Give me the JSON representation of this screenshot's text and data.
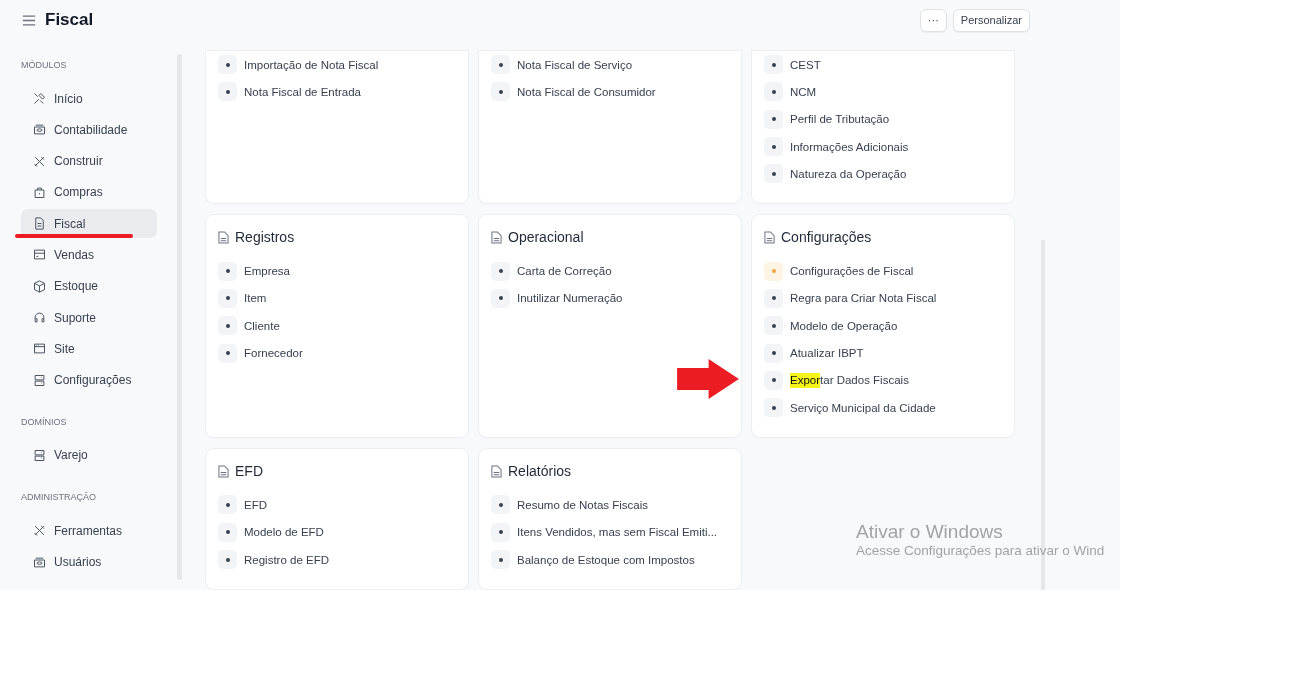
{
  "header": {
    "title": "Fiscal",
    "more_button": "···",
    "customize_button": "Personalizar"
  },
  "sidebar": {
    "sections": [
      {
        "heading": "MÓDULOS",
        "items": [
          {
            "label": "Início",
            "selected": false,
            "underlined": false
          },
          {
            "label": "Contabilidade",
            "selected": false,
            "underlined": false
          },
          {
            "label": "Construir",
            "selected": false,
            "underlined": false
          },
          {
            "label": "Compras",
            "selected": false,
            "underlined": false
          },
          {
            "label": "Fiscal",
            "selected": true,
            "underlined": true
          },
          {
            "label": "Vendas",
            "selected": false,
            "underlined": false
          },
          {
            "label": "Estoque",
            "selected": false,
            "underlined": false
          },
          {
            "label": "Suporte",
            "selected": false,
            "underlined": false
          },
          {
            "label": "Site",
            "selected": false,
            "underlined": false
          },
          {
            "label": "Configurações",
            "selected": false,
            "underlined": false
          }
        ]
      },
      {
        "heading": "DOMÍNIOS",
        "items": [
          {
            "label": "Varejo",
            "selected": false,
            "underlined": false
          }
        ]
      },
      {
        "heading": "ADMINISTRAÇÃO",
        "items": [
          {
            "label": "Ferramentas",
            "selected": false,
            "underlined": false
          },
          {
            "label": "Usuários",
            "selected": false,
            "underlined": false
          }
        ]
      }
    ]
  },
  "cards": [
    {
      "links": [
        {
          "label": "Importação de Nota Fiscal",
          "color": "#374151"
        },
        {
          "label": "Nota Fiscal de Entrada",
          "color": "#374151"
        }
      ]
    },
    {
      "links": [
        {
          "label": "Nota Fiscal de Serviço",
          "color": "#374151"
        },
        {
          "label": "Nota Fiscal de Consumidor",
          "color": "#374151"
        }
      ]
    },
    {
      "links": [
        {
          "label": "CEST",
          "color": "#374151"
        },
        {
          "label": "NCM",
          "color": "#374151"
        },
        {
          "label": "Perfil de Tributação",
          "color": "#374151"
        },
        {
          "label": "Informações Adicionais",
          "color": "#374151"
        },
        {
          "label": "Natureza da Operação",
          "color": "#374151"
        }
      ]
    },
    {
      "title": "Registros",
      "links": [
        {
          "label": "Empresa",
          "color": "#374151"
        },
        {
          "label": "Item",
          "color": "#374151"
        },
        {
          "label": "Cliente",
          "color": "#374151"
        },
        {
          "label": "Fornecedor",
          "color": "#374151"
        }
      ]
    },
    {
      "title": "Operacional",
      "links": [
        {
          "label": "Carta de Correção",
          "color": "#374151"
        },
        {
          "label": "Inutilizar Numeração",
          "color": "#374151"
        }
      ]
    },
    {
      "title": "Configurações",
      "links": [
        {
          "label": "Configurações de Fiscal",
          "color": "#f0a040"
        },
        {
          "label": "Regra para Criar Nota Fiscal",
          "color": "#374151"
        },
        {
          "label": "Modelo de Operação",
          "color": "#374151"
        },
        {
          "label": "Atualizar IBPT",
          "color": "#374151"
        },
        {
          "highlighted_part": "Expor",
          "rest": "tar Dados Fiscais",
          "pointed_at": true,
          "color": "#374151"
        },
        {
          "label": "Serviço Municipal da Cidade",
          "color": "#374151"
        }
      ]
    },
    {
      "title": "EFD",
      "links": [
        {
          "label": "EFD",
          "color": "#374151"
        },
        {
          "label": "Modelo de EFD",
          "color": "#374151"
        },
        {
          "label": "Registro de EFD",
          "color": "#374151"
        }
      ]
    },
    {
      "title": "Relatórios",
      "links": [
        {
          "label": "Resumo de Notas Fiscais",
          "color": "#374151"
        },
        {
          "label": "Itens Vendidos, mas sem Fiscal Emiti...",
          "color": "#374151"
        },
        {
          "label": "Balanço de Estoque com Impostos",
          "color": "#374151"
        }
      ]
    }
  ],
  "os_notice": {
    "title": "Ativar o Windows",
    "message": "Acesse Configurações para ativar o Wind"
  }
}
